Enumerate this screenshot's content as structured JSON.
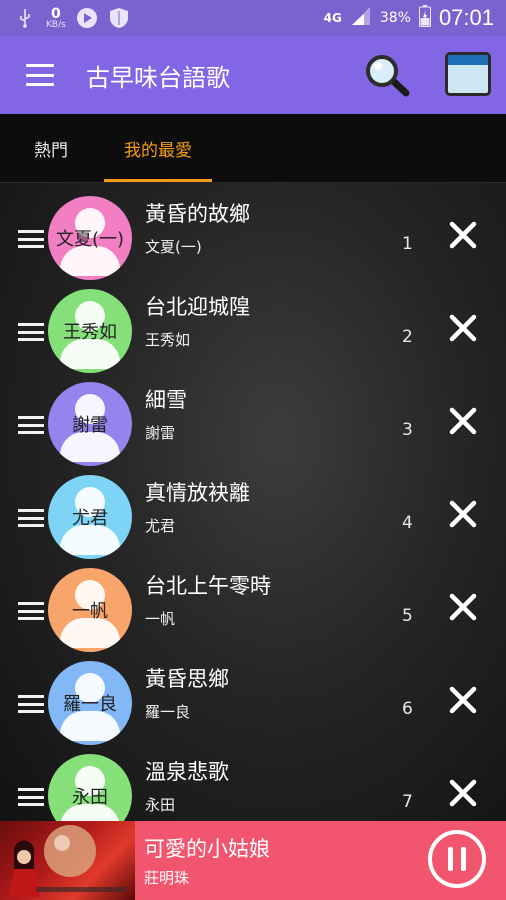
{
  "status": {
    "net_speed_value": "0",
    "net_speed_unit": "KB/s",
    "network": "4G",
    "battery": "38%",
    "time": "07:01"
  },
  "appbar": {
    "title": "古早味台語歌",
    "icons": [
      "menu-icon",
      "search-icon",
      "window-icon"
    ]
  },
  "tabs": [
    {
      "label": "熱門",
      "selected": false
    },
    {
      "label": "我的最愛",
      "selected": true
    }
  ],
  "tab_accent_color": "#f39a18",
  "songs": [
    {
      "title": "黃昏的故鄉",
      "artist": "文夏(一)",
      "avatar_text": "文夏(一)",
      "num": "1",
      "avatar_color": "#f27fc3"
    },
    {
      "title": "台北迎城隍",
      "artist": "王秀如",
      "avatar_text": "王秀如",
      "num": "2",
      "avatar_color": "#86e07a"
    },
    {
      "title": "細雪",
      "artist": "謝雷",
      "avatar_text": "謝雷",
      "num": "3",
      "avatar_color": "#9583ee"
    },
    {
      "title": "真情放袂離",
      "artist": "尤君",
      "avatar_text": "尤君",
      "num": "4",
      "avatar_color": "#7ed4f4"
    },
    {
      "title": "台北上午零時",
      "artist": "一帆",
      "avatar_text": "一帆",
      "num": "5",
      "avatar_color": "#f8a56c"
    },
    {
      "title": "黃昏思鄉",
      "artist": "羅一良",
      "avatar_text": "羅一良",
      "num": "6",
      "avatar_color": "#82b8f6"
    },
    {
      "title": "溫泉悲歌",
      "artist": "永田",
      "avatar_text": "永田",
      "num": "7",
      "avatar_color": "#86e07a"
    }
  ],
  "player": {
    "title": "可愛的小姑娘",
    "artist": "莊明珠",
    "state": "playing",
    "background_color": "#f1566e"
  }
}
